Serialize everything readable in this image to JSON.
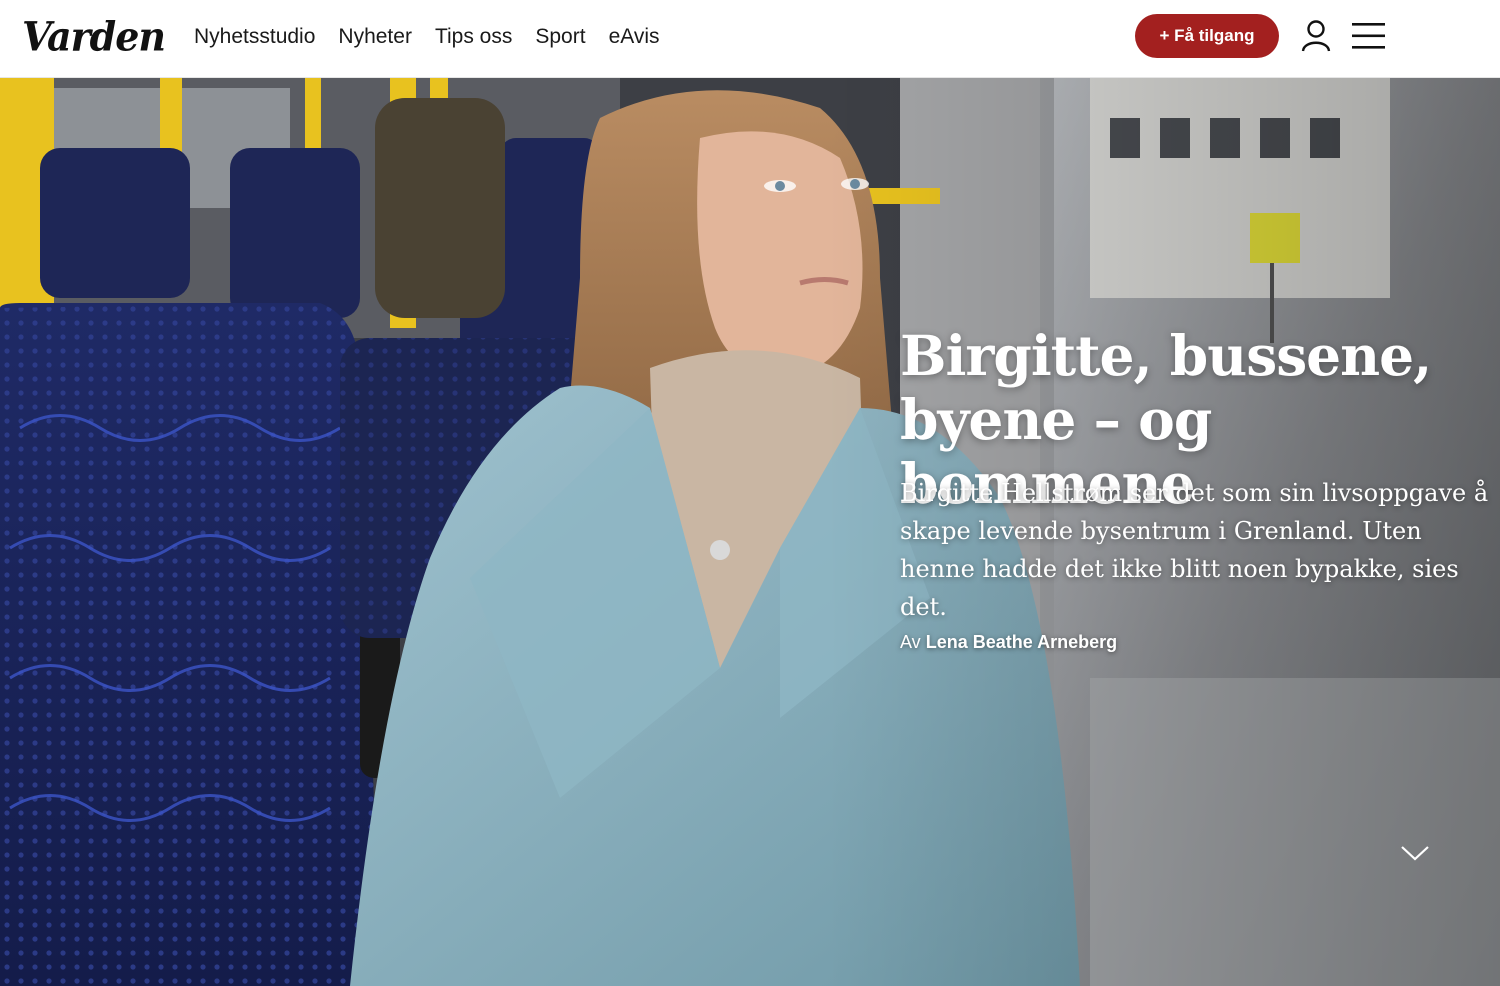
{
  "site": {
    "logo": "Varden"
  },
  "nav": {
    "items": [
      {
        "label": "Nyhetsstudio"
      },
      {
        "label": "Nyheter"
      },
      {
        "label": "Tips oss"
      },
      {
        "label": "Sport"
      },
      {
        "label": "eAvis"
      }
    ],
    "cta_label": "+ Få tilgang",
    "cta_color": "#a3201f",
    "user_icon": "user-icon",
    "menu_icon": "hamburger-menu-icon"
  },
  "article": {
    "headline": "Birgitte, bussene, byene – og bommene",
    "lead": "Birgitte Hellstrøm ser det som sin livsoppgave å skape levende bysentrum i Grenland. Uten henne hadde det ikke blitt noen bypakke, sies det.",
    "byline_prefix": "Av",
    "author": "Lena Beathe Arneberg",
    "scroll_icon": "chevron-down-icon"
  }
}
